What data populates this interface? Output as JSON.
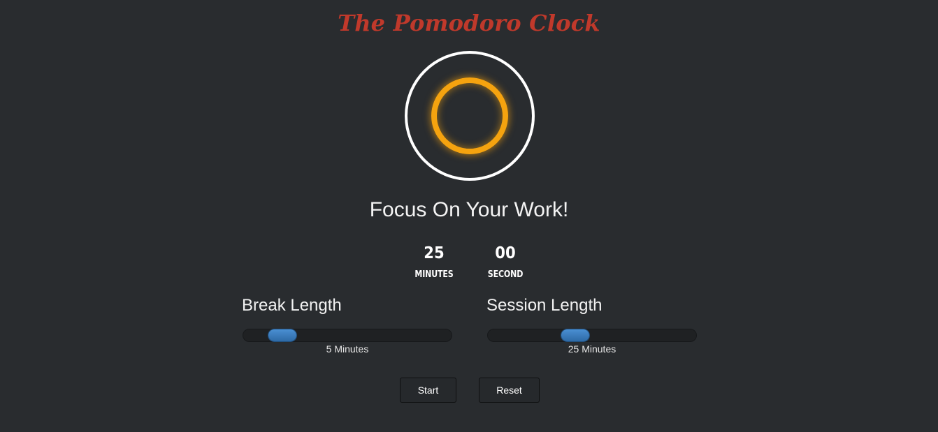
{
  "app": {
    "title": "The Pomodoro Clock"
  },
  "clock": {
    "status_text": "Focus On Your Work!",
    "minutes_value": "25",
    "minutes_label": "MINUTES",
    "seconds_value": "00",
    "seconds_label": "SECOND",
    "colors": {
      "title": "#c0392b",
      "ring_outer": "#ffffff",
      "ring_inner": "#f5a30f",
      "background": "#292c2f"
    }
  },
  "settings": {
    "break": {
      "label": "Break Length",
      "caption": "5 Minutes",
      "value": 5
    },
    "session": {
      "label": "Session Length",
      "caption": "25 Minutes",
      "value": 25
    },
    "slider_color": "#3a7cc1"
  },
  "controls": {
    "start_label": "Start",
    "reset_label": "Reset"
  }
}
